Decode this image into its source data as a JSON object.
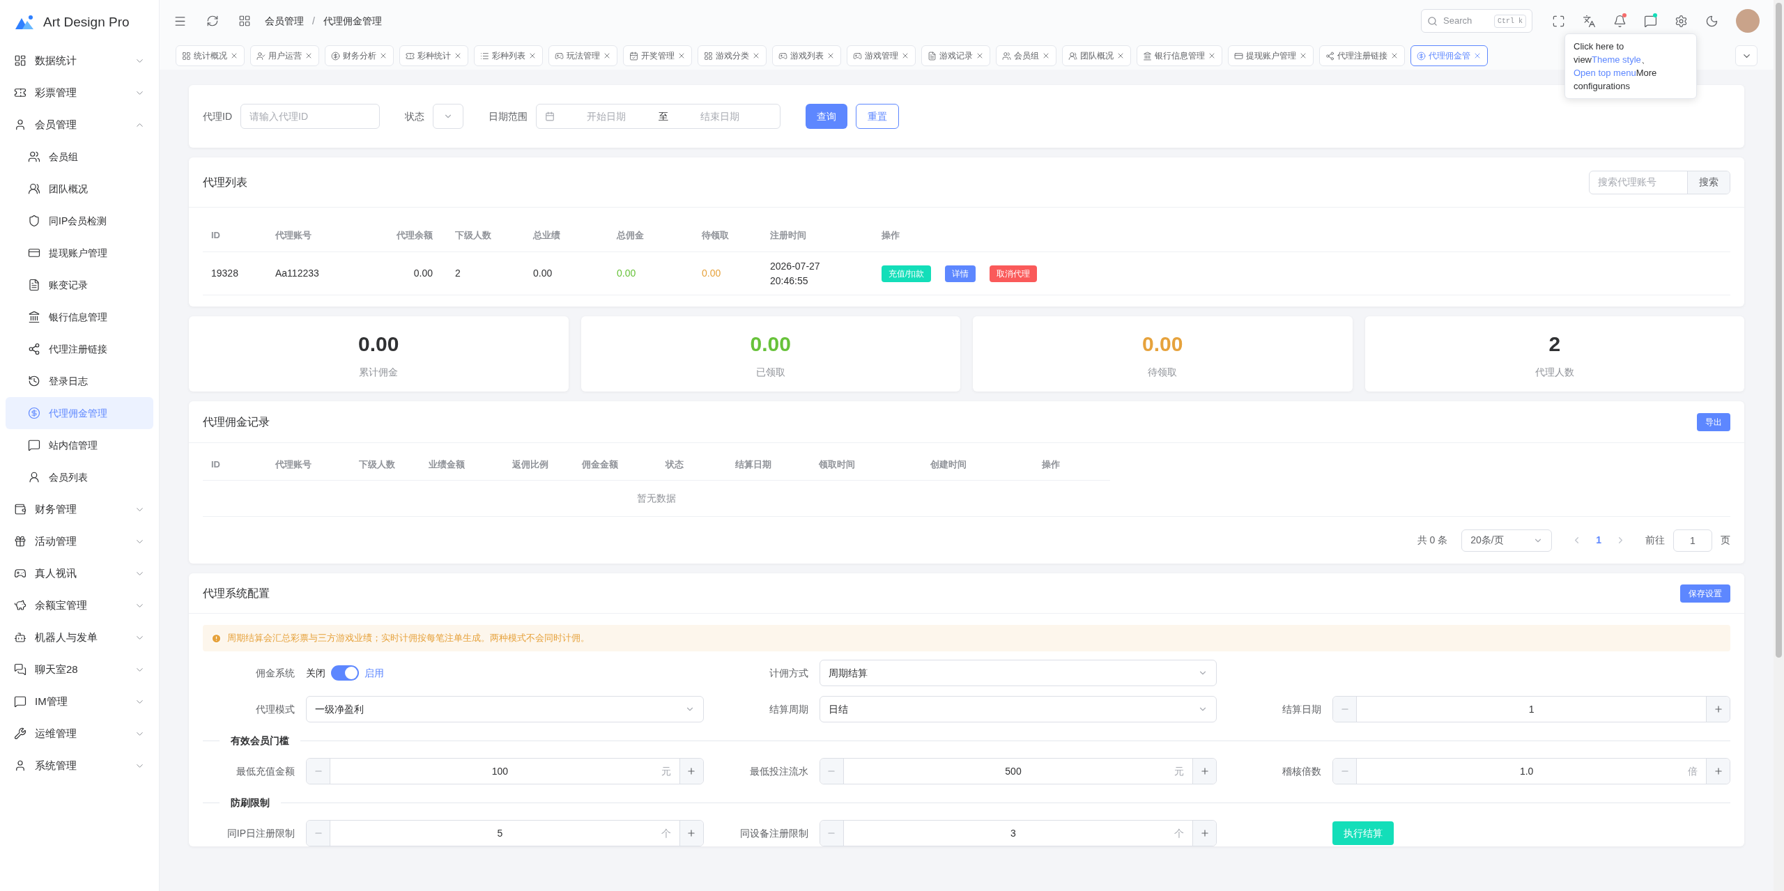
{
  "sidebar": {
    "logo": "Art Design Pro",
    "items": [
      {
        "label": "数据统计",
        "expanded": false
      },
      {
        "label": "彩票管理",
        "expanded": false
      },
      {
        "label": "会员管理",
        "expanded": true,
        "children": [
          {
            "label": "会员组",
            "selected": false
          },
          {
            "label": "团队概况",
            "selected": false
          },
          {
            "label": "同IP会员检测",
            "selected": false
          },
          {
            "label": "提现账户管理",
            "selected": false
          },
          {
            "label": "账变记录",
            "selected": false
          },
          {
            "label": "银行信息管理",
            "selected": false
          },
          {
            "label": "代理注册链接",
            "selected": false
          },
          {
            "label": "登录日志",
            "selected": false
          },
          {
            "label": "代理佣金管理",
            "selected": true
          },
          {
            "label": "站内信管理",
            "selected": false
          },
          {
            "label": "会员列表",
            "selected": false
          }
        ]
      },
      {
        "label": "财务管理",
        "expanded": false
      },
      {
        "label": "活动管理",
        "expanded": false
      },
      {
        "label": "真人视讯",
        "expanded": false
      },
      {
        "label": "余额宝管理",
        "expanded": false
      },
      {
        "label": "机器人与发单",
        "expanded": false
      },
      {
        "label": "聊天室28",
        "expanded": false
      },
      {
        "label": "IM管理",
        "expanded": false
      },
      {
        "label": "运维管理",
        "expanded": false
      },
      {
        "label": "系统管理",
        "expanded": false
      }
    ]
  },
  "header": {
    "breadcrumb": [
      "会员管理",
      "代理佣金管理"
    ],
    "separator": "/",
    "search": {
      "placeholder": "Search",
      "shortcut": "Ctrl k"
    },
    "bell_badge": true,
    "chat_badge": true
  },
  "tabs": [
    {
      "label": "统计概况",
      "selected": false
    },
    {
      "label": "用户运营",
      "selected": false
    },
    {
      "label": "财务分析",
      "selected": false
    },
    {
      "label": "彩种统计",
      "selected": false
    },
    {
      "label": "彩种列表",
      "selected": false
    },
    {
      "label": "玩法管理",
      "selected": false
    },
    {
      "label": "开奖管理",
      "selected": false
    },
    {
      "label": "游戏分类",
      "selected": false
    },
    {
      "label": "游戏列表",
      "selected": false
    },
    {
      "label": "游戏管理",
      "selected": false
    },
    {
      "label": "游戏记录",
      "selected": false
    },
    {
      "label": "会员组",
      "selected": false
    },
    {
      "label": "团队概况",
      "selected": false
    },
    {
      "label": "银行信息管理",
      "selected": false
    },
    {
      "label": "提现账户管理",
      "selected": false
    },
    {
      "label": "代理注册链接",
      "selected": false
    },
    {
      "label": "代理佣金管",
      "selected": true
    }
  ],
  "tooltip": {
    "parts": [
      {
        "kind": "text",
        "text": "Click here to view"
      },
      {
        "kind": "link",
        "text": "Theme style"
      },
      {
        "kind": "text",
        "text": "、 "
      },
      {
        "kind": "link",
        "text": "Open top menu"
      },
      {
        "kind": "text",
        "text": "More configurations"
      }
    ]
  },
  "filter": {
    "agent_id": {
      "label": "代理ID",
      "placeholder": "请输入代理ID"
    },
    "status": {
      "label": "状态"
    },
    "date_range": {
      "label": "日期范围",
      "start_placeholder": "开始日期",
      "separator": "至",
      "end_placeholder": "结束日期"
    },
    "buttons": [
      {
        "label": "查询",
        "kind": "primary"
      },
      {
        "label": "重置",
        "kind": "outline"
      }
    ]
  },
  "agent_list": {
    "title": "代理列表",
    "search": {
      "placeholder": "搜索代理账号",
      "button": "搜索"
    },
    "columns": [
      "ID",
      "代理账号",
      "代理余额",
      "下级人数",
      "总业绩",
      "总佣金",
      "待领取",
      "注册时间",
      "操作"
    ],
    "rows": [
      {
        "cells": [
          {
            "text": "19328"
          },
          {
            "text": "Aa112233"
          },
          {
            "text": "0.00"
          },
          {
            "text": "2"
          },
          {
            "text": "0.00"
          },
          {
            "text": "0.00",
            "color": "#67c23a"
          },
          {
            "text": "0.00",
            "color": "#e6a23c"
          },
          {
            "text": "2026-07-27 20:46:55"
          }
        ],
        "actions": [
          {
            "label": "充值/扣款",
            "kind": "success"
          },
          {
            "label": "详情",
            "kind": "primary"
          },
          {
            "label": "取消代理",
            "kind": "danger"
          }
        ]
      }
    ]
  },
  "stats": [
    {
      "value": "0.00",
      "label": "累计佣金"
    },
    {
      "value": "0.00",
      "label": "已领取",
      "color": "#67c23a"
    },
    {
      "value": "0.00",
      "label": "待领取",
      "color": "#e6a23c"
    },
    {
      "value": "2",
      "label": "代理人数"
    }
  ],
  "records": {
    "title": "代理佣金记录",
    "export": "导出",
    "columns": [
      "ID",
      "代理账号",
      "下级人数",
      "业绩金额",
      "返佣比例",
      "佣金金额",
      "状态",
      "结算日期",
      "领取时间",
      "创建时间",
      "操作"
    ],
    "empty": "暂无数据",
    "pagination": {
      "total": "共 0 条",
      "page_size": "20条/页",
      "pages": [
        {
          "label": "1",
          "selected": true
        }
      ],
      "goto_label": "前往",
      "goto_value": "1",
      "page_suffix": "页"
    }
  },
  "config": {
    "title": "代理系统配置",
    "save": "保存设置",
    "alert": "周期结算会汇总彩票与三方游戏业绩；实时计佣按每笔注单生成。两种模式不会同时计佣。",
    "groups": [
      {
        "rows": [
          [
            {
              "kind": "switch",
              "label": "佣金系统",
              "off_text": "关闭",
              "on_text": "启用",
              "on": true
            },
            {
              "kind": "select",
              "label": "计佣方式",
              "value": "周期结算"
            }
          ],
          [
            {
              "kind": "select",
              "label": "代理模式",
              "value": "一级净盈利"
            },
            {
              "kind": "select",
              "label": "结算周期",
              "value": "日结"
            },
            {
              "kind": "number",
              "label": "结算日期",
              "value": "1"
            }
          ]
        ]
      },
      {
        "title": "有效会员门槛",
        "rows": [
          [
            {
              "kind": "number",
              "label": "最低充值金额",
              "value": "100",
              "unit": "元"
            },
            {
              "kind": "number",
              "label": "最低投注流水",
              "value": "500",
              "unit": "元"
            },
            {
              "kind": "number",
              "label": "稽核倍数",
              "value": "1.0",
              "unit": "倍"
            }
          ]
        ]
      },
      {
        "title": "防刷限制",
        "rows": [
          [
            {
              "kind": "number",
              "label": "同IP日注册限制",
              "value": "5",
              "unit": "个"
            },
            {
              "kind": "number",
              "label": "同设备注册限制",
              "value": "3",
              "unit": "个"
            },
            {
              "kind": "button",
              "label": "执行结算"
            }
          ]
        ]
      }
    ]
  }
}
